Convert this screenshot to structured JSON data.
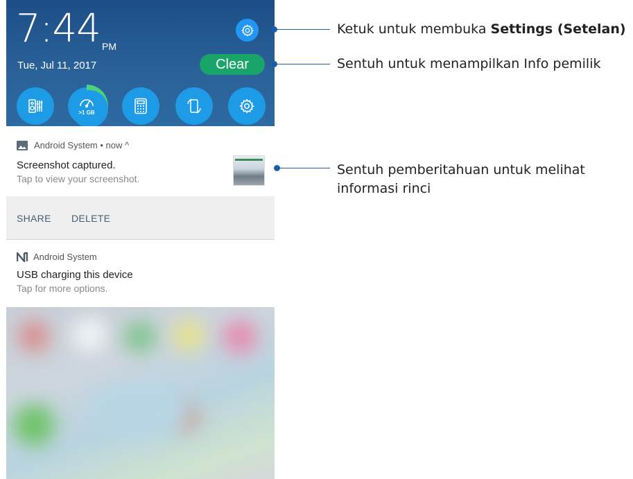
{
  "status": {
    "clock": "7:44",
    "ampm": "PM",
    "date": "Tue, Jul 11, 2017"
  },
  "buttons": {
    "clear_label": "Clear"
  },
  "quick_settings": {
    "items": [
      {
        "name": "audio-wizard-icon"
      },
      {
        "name": "boost-icon",
        "text": ">1 GB",
        "ring_color": "#4cd37a"
      },
      {
        "name": "calculator-icon"
      },
      {
        "name": "auto-rotate-icon"
      },
      {
        "name": "settings-icon"
      }
    ],
    "accent": "#1e9be6"
  },
  "notifications": [
    {
      "app": "Android System",
      "meta": " • now ^",
      "title": "Screenshot captured.",
      "text": "Tap to view your screenshot.",
      "actions": [
        "SHARE",
        "DELETE"
      ]
    },
    {
      "app": "Android System",
      "title": "USB charging this device",
      "text": "Tap for more options."
    }
  ],
  "annotations": {
    "settings_pre": "Ketuk untuk membuka ",
    "settings_bold": "Settings (Setelan)",
    "owner_info": "Sentuh untuk menampilkan Info pemilik",
    "notif_line1": "Sentuh pemberitahuan untuk melihat",
    "notif_line2": "informasi rinci"
  },
  "colors": {
    "shade_top": "#1d4e87",
    "clear_button": "#19a46a",
    "settings_button": "#2196f3",
    "callout_line": "#1a5fa6"
  }
}
